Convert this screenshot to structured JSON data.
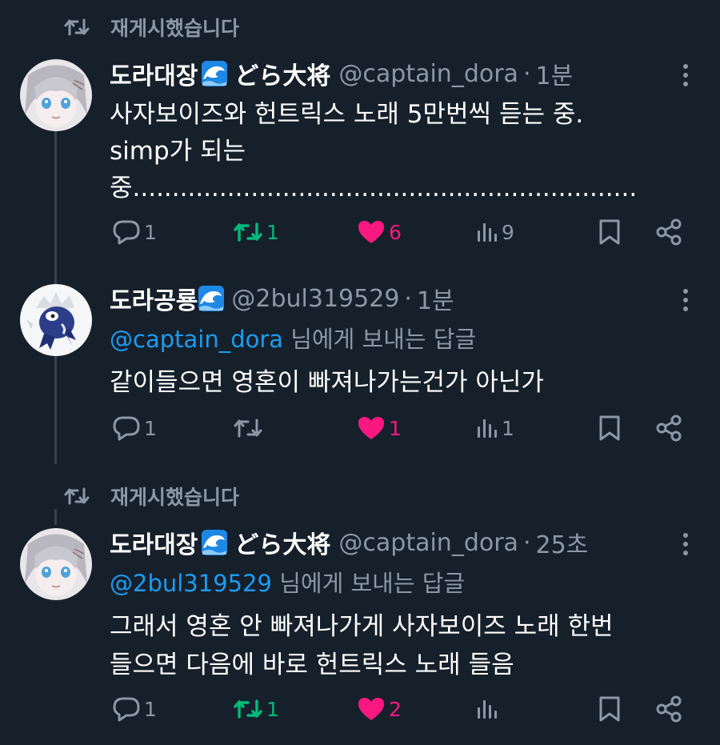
{
  "colors": {
    "background": "#15202b",
    "text_primary": "#ffffff",
    "text_secondary": "#8b98a5",
    "mention": "#1d9bf0",
    "retweet_active": "#00ba7c",
    "like_active": "#f91880",
    "thread_line": "#38444d"
  },
  "repost_label_1": "재게시했습니다",
  "repost_label_2": "재게시했습니다",
  "tweets": [
    {
      "display_name": "도라대장",
      "display_name_suffix": "どら大将",
      "emoji": "water-wave-emoji",
      "handle": "@captain_dora",
      "separator": "·",
      "time": "1분",
      "replying_to": null,
      "text_lines": [
        "사자보이즈와 헌트릭스 노래 5만번씩 듣는 중.",
        "simp가 되는",
        "중................................................................"
      ],
      "actions": {
        "reply": "1",
        "retweet": "1",
        "like": "6",
        "views": "9"
      },
      "retweet_active": true,
      "liked": true
    },
    {
      "display_name": "도라공룡",
      "display_name_suffix": "",
      "emoji": "water-wave-emoji",
      "handle": "@2bul319529",
      "separator": "·",
      "time": "1분",
      "replying_to": {
        "mention": "@captain_dora",
        "suffix": " 님에게 보내는 답글"
      },
      "text_lines": [
        "같이들으면 영혼이 빠져나가는건가 아닌가"
      ],
      "actions": {
        "reply": "1",
        "retweet": "",
        "like": "1",
        "views": "1"
      },
      "retweet_active": false,
      "liked": true
    },
    {
      "display_name": "도라대장",
      "display_name_suffix": "どら大将",
      "emoji": "water-wave-emoji",
      "handle": "@captain_dora",
      "separator": "·",
      "time": "25초",
      "replying_to": {
        "mention": "@2bul319529",
        "suffix": " 님에게 보내는 답글"
      },
      "text_lines": [
        "그래서 영혼 안 빠져나가게 사자보이즈 노래 한번",
        "들으면 다음에 바로 헌트릭스 노래 들음"
      ],
      "actions": {
        "reply": "1",
        "retweet": "1",
        "like": "2",
        "views": ""
      },
      "retweet_active": true,
      "liked": true
    }
  ]
}
